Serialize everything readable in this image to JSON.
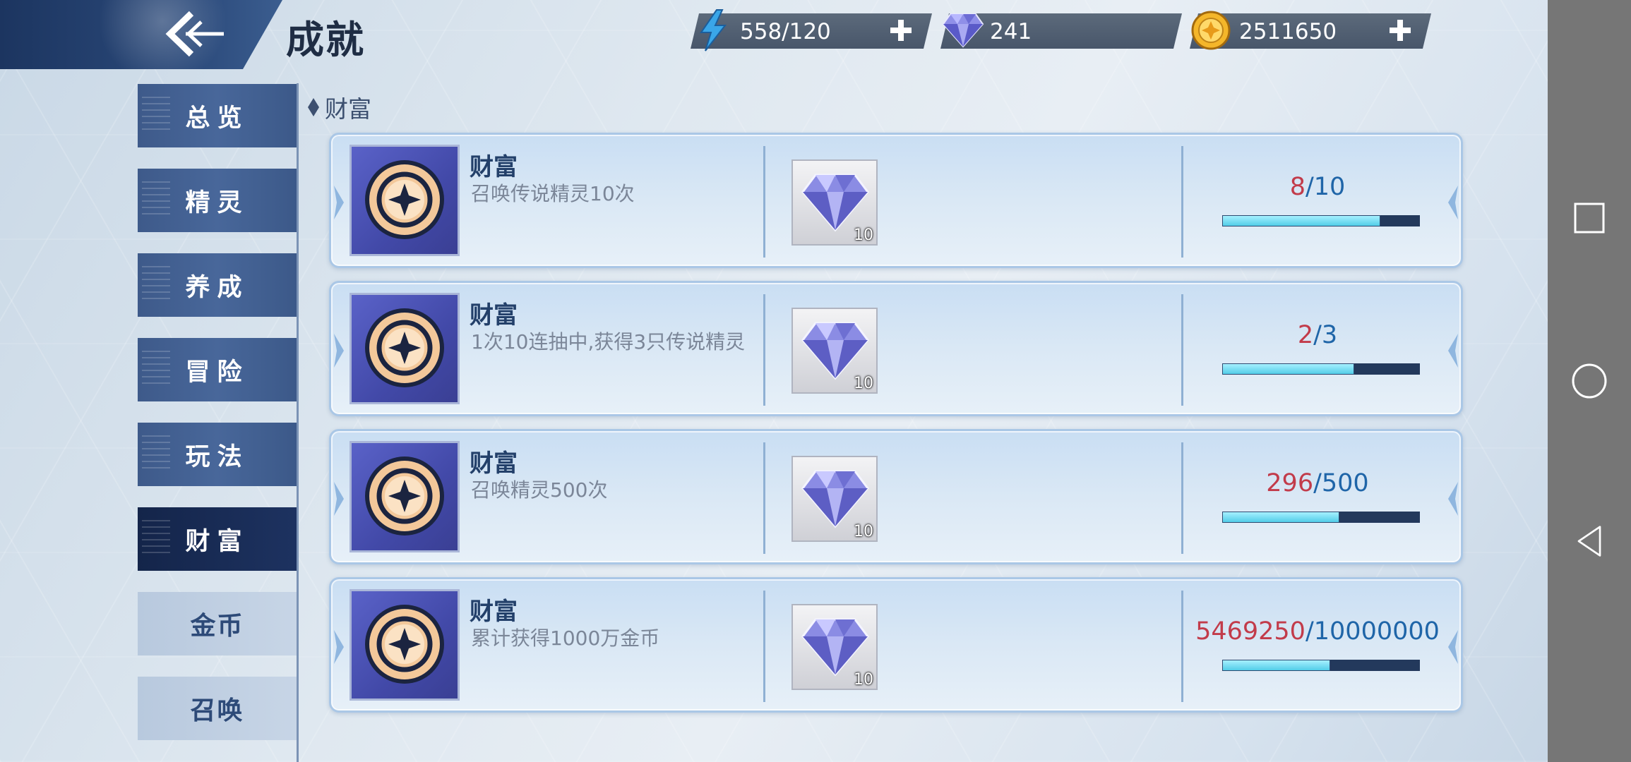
{
  "header": {
    "title": "成就"
  },
  "resources": {
    "stamina": {
      "value": "558/120",
      "icon": "lightning-icon"
    },
    "diamond": {
      "value": "241",
      "icon": "diamond-icon"
    },
    "gold": {
      "value": "2511650",
      "icon": "gold-coin-icon"
    }
  },
  "sidebar": {
    "items": [
      {
        "label": "总览"
      },
      {
        "label": "精灵"
      },
      {
        "label": "养成"
      },
      {
        "label": "冒险"
      },
      {
        "label": "玩法"
      },
      {
        "label": "财富"
      },
      {
        "label": "金币"
      },
      {
        "label": "召唤"
      }
    ]
  },
  "section": {
    "heading": "财富"
  },
  "achievements": [
    {
      "title": "财富",
      "desc": "召唤传说精灵10次",
      "reward_count": "10",
      "current": "8",
      "max": "10",
      "progress": 0.8
    },
    {
      "title": "财富",
      "desc": "1次10连抽中,获得3只传说精灵",
      "reward_count": "10",
      "current": "2",
      "max": "3",
      "progress": 0.667
    },
    {
      "title": "财富",
      "desc": "召唤精灵500次",
      "reward_count": "10",
      "current": "296",
      "max": "500",
      "progress": 0.592
    },
    {
      "title": "财富",
      "desc": "累计获得1000万金币",
      "reward_count": "10",
      "current": "5469250",
      "max": "10000000",
      "progress": 0.547
    }
  ],
  "colors": {
    "current": "#c23b4a",
    "max": "#1f65a8",
    "active_tab": "#14254a"
  }
}
